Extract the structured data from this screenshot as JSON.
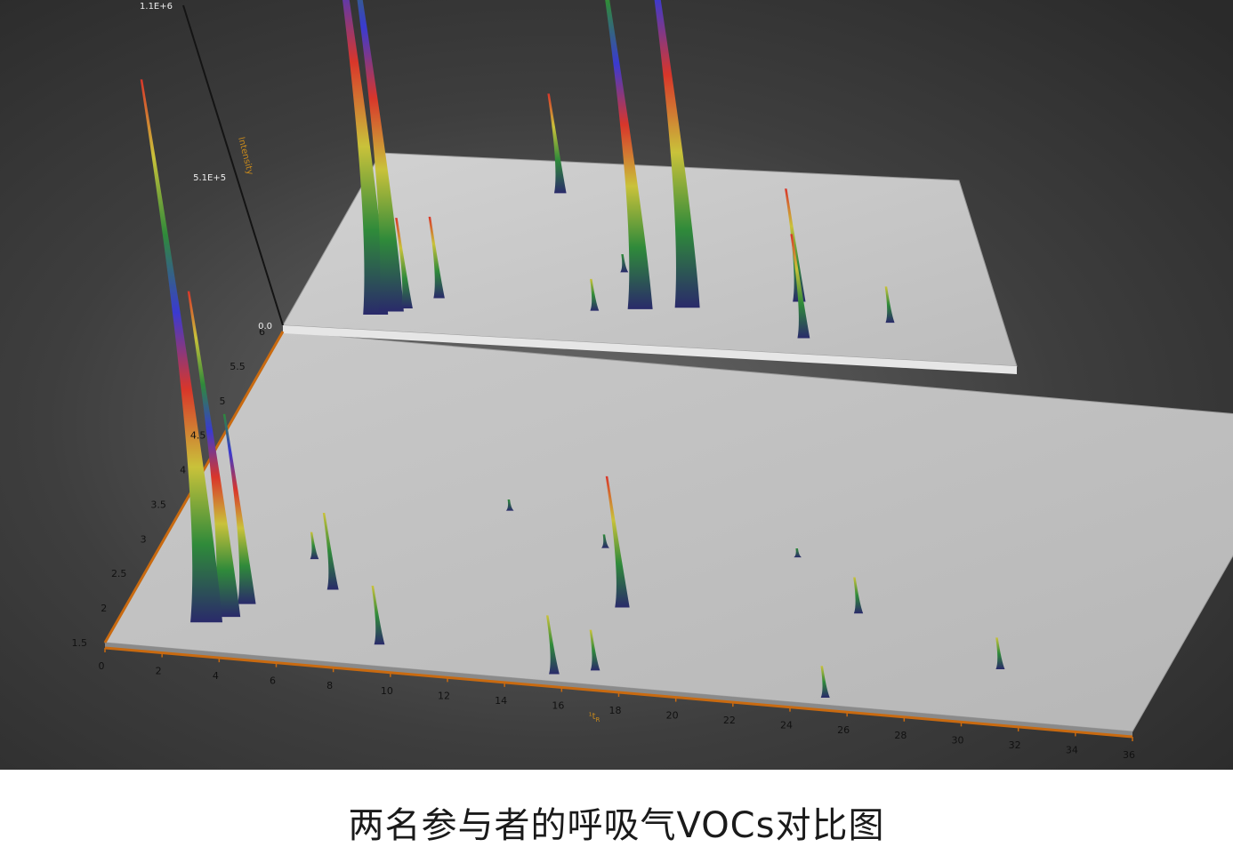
{
  "caption": "两名参与者的呼吸气VOCs对比图",
  "chart_data": {
    "type": "surface3d",
    "title": "两名参与者的呼吸气VOCs对比图",
    "xlabel": "¹t_R",
    "xlabel_text": "¹t",
    "xlabel_sub": "R",
    "zlabel": "Intensity",
    "x_ticks": [
      "0",
      "2",
      "4",
      "6",
      "8",
      "10",
      "12",
      "14",
      "16",
      "18",
      "20",
      "22",
      "24",
      "26",
      "28",
      "30",
      "32",
      "34",
      "36"
    ],
    "y_ticks": [
      "1.5",
      "2",
      "2.5",
      "3",
      "3.5",
      "4",
      "4.5",
      "5",
      "5.5",
      "6"
    ],
    "z_ticks": [
      "0.0",
      "5.1E+5",
      "1.1E+6"
    ],
    "xlim": [
      0,
      36
    ],
    "ylim": [
      1.5,
      6
    ],
    "zlim": [
      0,
      1100000
    ],
    "colorscale": [
      "#2a2a6a",
      "#2f8a3a",
      "#c9c23a",
      "#d9362a",
      "#3a3ad0",
      "#2f8a3a",
      "#c9c23a",
      "#d9362a"
    ],
    "series": [
      {
        "name": "",
        "peaks": [
          {
            "x": 3.0,
            "y": 1.9,
            "z": 1200000
          },
          {
            "x": 3.6,
            "y": 2.0,
            "z": 720000
          },
          {
            "x": 4.0,
            "y": 2.2,
            "z": 420000
          },
          {
            "x": 6.6,
            "y": 2.5,
            "z": 170000
          },
          {
            "x": 9.2,
            "y": 1.8,
            "z": 130000
          },
          {
            "x": 5.4,
            "y": 2.9,
            "z": 60000
          },
          {
            "x": 15.6,
            "y": 1.6,
            "z": 130000
          },
          {
            "x": 16.9,
            "y": 1.7,
            "z": 90000
          },
          {
            "x": 16.6,
            "y": 2.6,
            "z": 290000
          },
          {
            "x": 24.6,
            "y": 2.8,
            "z": 80000
          },
          {
            "x": 25.1,
            "y": 1.6,
            "z": 70000
          },
          {
            "x": 30.4,
            "y": 2.2,
            "z": 70000
          },
          {
            "x": 14.9,
            "y": 3.4,
            "z": 30000
          },
          {
            "x": 11.0,
            "y": 3.8,
            "z": 25000
          },
          {
            "x": 21.5,
            "y": 3.5,
            "z": 20000
          }
        ]
      },
      {
        "name": "",
        "peaks": [
          {
            "x": 4.2,
            "y": 1.9,
            "z": 1300000
          },
          {
            "x": 4.9,
            "y": 2.0,
            "z": 1100000
          },
          {
            "x": 5.6,
            "y": 2.1,
            "z": 200000
          },
          {
            "x": 7.0,
            "y": 2.4,
            "z": 180000
          },
          {
            "x": 11.7,
            "y": 5.2,
            "z": 220000
          },
          {
            "x": 17.3,
            "y": 2.4,
            "z": 950000
          },
          {
            "x": 19.7,
            "y": 2.5,
            "z": 1200000
          },
          {
            "x": 25.5,
            "y": 2.8,
            "z": 250000
          },
          {
            "x": 25.6,
            "y": 1.9,
            "z": 230000
          },
          {
            "x": 30.1,
            "y": 2.4,
            "z": 80000
          },
          {
            "x": 15.0,
            "y": 2.3,
            "z": 70000
          },
          {
            "x": 16.2,
            "y": 3.3,
            "z": 40000
          }
        ]
      }
    ]
  }
}
